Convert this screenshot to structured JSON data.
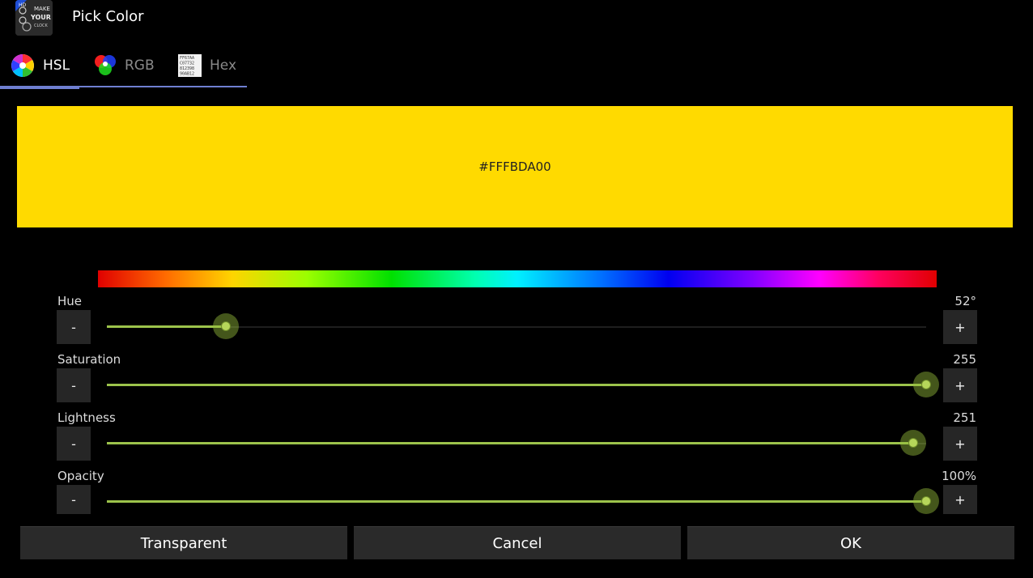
{
  "app": {
    "title": "Pick Color",
    "icon_text": [
      "MAKE",
      "YOUR",
      "CLOCK"
    ],
    "icon_badge": "HD"
  },
  "tabs": [
    {
      "label": "HSL",
      "icon": "color-wheel-icon",
      "active": true
    },
    {
      "label": "RGB",
      "icon": "rgb-circles-icon",
      "active": false
    },
    {
      "label": "Hex",
      "icon": "hex-code-icon",
      "active": false
    }
  ],
  "hex_icon_text": [
    "FF67AA",
    "C07732",
    "812398",
    "90AB12"
  ],
  "preview": {
    "color": "#FFBDA00",
    "hex_label": "#FFFBDA00"
  },
  "sliders": {
    "hue": {
      "label": "Hue",
      "value": "52°",
      "level": 0.145
    },
    "saturation": {
      "label": "Saturation",
      "value": "255",
      "level": 1.0
    },
    "lightness": {
      "label": "Lightness",
      "value": "251",
      "level": 0.984
    },
    "opacity": {
      "label": "Opacity",
      "value": "100%",
      "level": 1.0
    }
  },
  "controls": {
    "minus": "-",
    "plus": "+"
  },
  "buttons": {
    "transparent": "Transparent",
    "cancel": "Cancel",
    "ok": "OK"
  },
  "colors": {
    "accent": "#6f7fd1",
    "slider_fill": "#9cc34b",
    "preview_fill": "#FFDA00"
  }
}
